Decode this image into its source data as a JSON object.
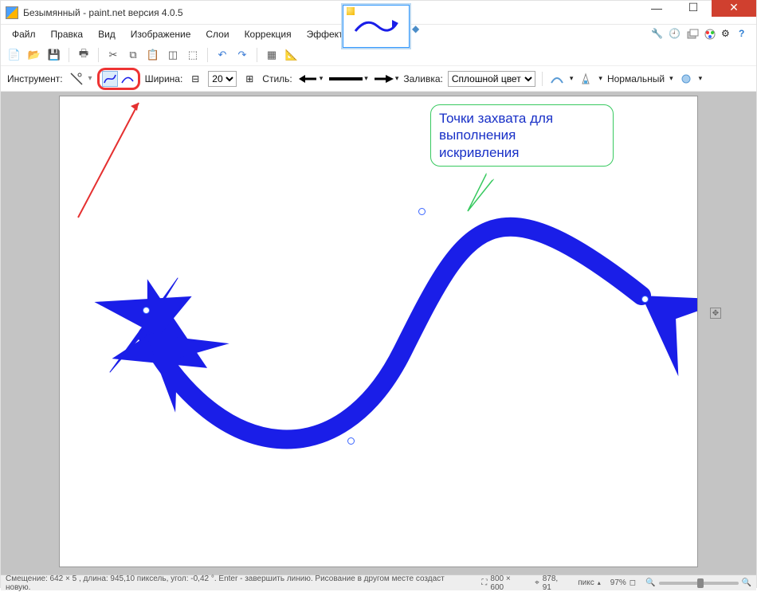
{
  "window": {
    "title": "Безымянный - paint.net версия 4.0.5"
  },
  "menu": {
    "file": "Файл",
    "edit": "Правка",
    "view": "Вид",
    "image": "Изображение",
    "layers": "Слои",
    "adjust": "Коррекция",
    "effects": "Эффекты"
  },
  "toolbar": {
    "tool_label": "Инструмент:",
    "width_label": "Ширина:",
    "width_value": "20",
    "style_label": "Стиль:",
    "fill_label": "Заливка:",
    "fill_value": "Сплошной цвет",
    "blend_label": "Нормальный"
  },
  "callout": {
    "line1": "Точки захвата для",
    "line2": "выполнения",
    "line3": "искривления"
  },
  "status": {
    "hint": "Смещение: 642  × 5 , длина: 945,10 пиксель, угол: -0,42 °. Enter - завершить линию. Рисование в другом месте создаст новую.",
    "size": "800 × 600",
    "pos": "878, 91",
    "unit": "пикс",
    "zoom": "97%"
  },
  "colors": {
    "arrow": "#1a1ee8",
    "highlight": "#e53030",
    "callout_border": "#37c95f",
    "callout_text": "#1830c7"
  }
}
